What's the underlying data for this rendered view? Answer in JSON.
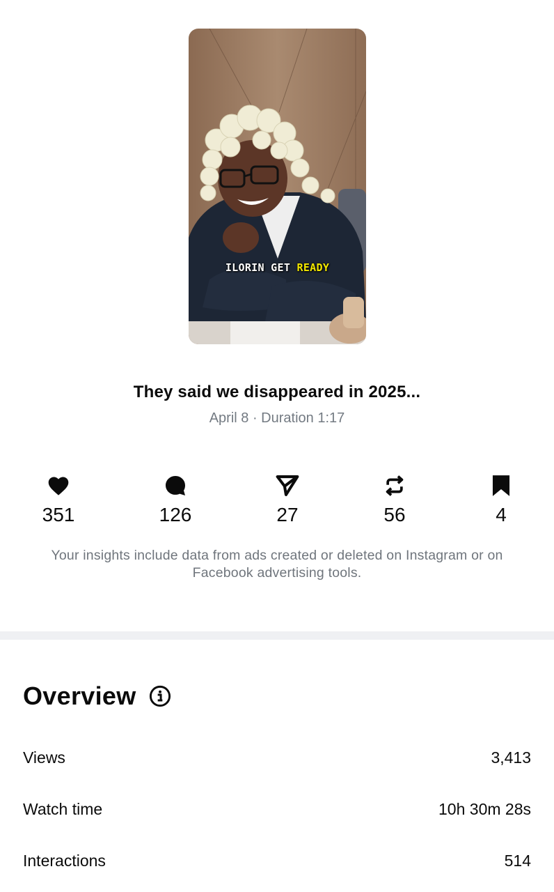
{
  "video": {
    "overlay_text": "ILORIN GET",
    "overlay_highlight": "READY"
  },
  "post": {
    "title": "They said we disappeared in 2025...",
    "meta": "April 8 · Duration 1:17"
  },
  "stats": [
    {
      "icon": "heart-icon",
      "value": "351"
    },
    {
      "icon": "comment-icon",
      "value": "126"
    },
    {
      "icon": "share-icon",
      "value": "27"
    },
    {
      "icon": "repost-icon",
      "value": "56"
    },
    {
      "icon": "bookmark-icon",
      "value": "4"
    }
  ],
  "notice": "Your insights include data from ads created or deleted on Instagram or on Facebook advertising tools.",
  "overview": {
    "title": "Overview",
    "info_icon": "info-icon",
    "rows": [
      {
        "label": "Views",
        "value": "3,413"
      },
      {
        "label": "Watch time",
        "value": "10h 30m 28s"
      },
      {
        "label": "Interactions",
        "value": "514"
      }
    ]
  },
  "colors": {
    "text": "#0b0b0b",
    "muted": "#737a82",
    "divider": "#eff0f3",
    "caption_highlight": "#f2e700"
  }
}
